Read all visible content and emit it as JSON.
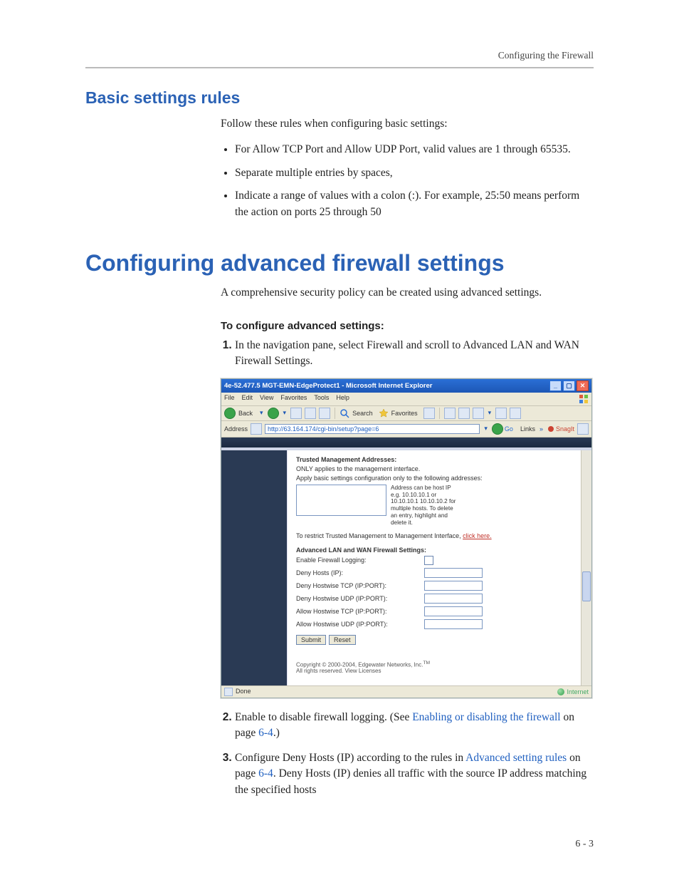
{
  "running_head": "Configuring the Firewall",
  "h2_basic": "Basic settings rules",
  "basic_intro": "Follow these rules when configuring basic settings:",
  "bullets": [
    "For Allow TCP Port and Allow UDP Port, valid values are 1 through 65535.",
    "Separate multiple entries by spaces,",
    "Indicate a range of values with a colon (:). For example, 25:50 means perform the action on ports 25 through 50"
  ],
  "h1_advanced": "Configuring advanced firewall settings",
  "adv_intro": "A comprehensive security policy can be created using advanced settings.",
  "h3_configure": "To configure advanced settings:",
  "step1": "In the navigation pane, select Firewall and scroll to Advanced LAN and WAN Firewall Settings.",
  "step2_pre": "Enable to disable firewall logging. (See ",
  "step2_link": "Enabling or disabling the firewall",
  "step2_post_a": " on page ",
  "step2_page": "6-4",
  "step2_post_b": ".)",
  "step3_pre": "Configure Deny Hosts (IP) according to the rules in ",
  "step3_link": "Advanced setting rules",
  "step3_post_a": " on page ",
  "step3_page": "6-4",
  "step3_post_b": ". Deny Hosts (IP) denies all traffic with the source IP address matching the specified hosts",
  "page_number": "6 - 3",
  "shot": {
    "title": "4e-52.477.5 MGT-EMN-EdgeProtect1 - Microsoft Internet Explorer",
    "menu": {
      "file": "File",
      "edit": "Edit",
      "view": "View",
      "favorites": "Favorites",
      "tools": "Tools",
      "help": "Help"
    },
    "toolbar": {
      "back": "Back",
      "search": "Search",
      "favorites": "Favorites"
    },
    "addr_label": "Address",
    "addr_value": "http://63.164.174/cgi-bin/setup?page=6",
    "go": "Go",
    "links": "Links",
    "snagit": "SnagIt",
    "section_tma": "Trusted Management Addresses:",
    "tma_note_1": "ONLY applies to the management interface.",
    "tma_note_2": "Apply basic settings configuration only to the following addresses:",
    "tma_help": "Address can be host IP e.g. 10.10.10.1 or 10.10.10.1 10.10.10.2 for multiple hosts. To delete an entry, highlight and delete it.",
    "restrict_pre": "To restrict Trusted Management to Management Interface, ",
    "restrict_link": "click here.",
    "section_adv": "Advanced LAN and WAN Firewall Settings:",
    "rows": {
      "logging": "Enable Firewall Logging:",
      "deny_ip": "Deny Hosts (IP):",
      "deny_tcp": "Deny Hostwise TCP (IP:PORT):",
      "deny_udp": "Deny Hostwise UDP (IP:PORT):",
      "allow_tcp": "Allow Hostwise TCP (IP:PORT):",
      "allow_udp": "Allow Hostwise UDP (IP:PORT):"
    },
    "submit": "Submit",
    "reset": "Reset",
    "copyright_a": "Copyright © 2000-2004, Edgewater Networks, Inc.",
    "copyright_b": "All rights reserved. View Licenses",
    "status_done": "Done",
    "status_zone": "Internet"
  }
}
